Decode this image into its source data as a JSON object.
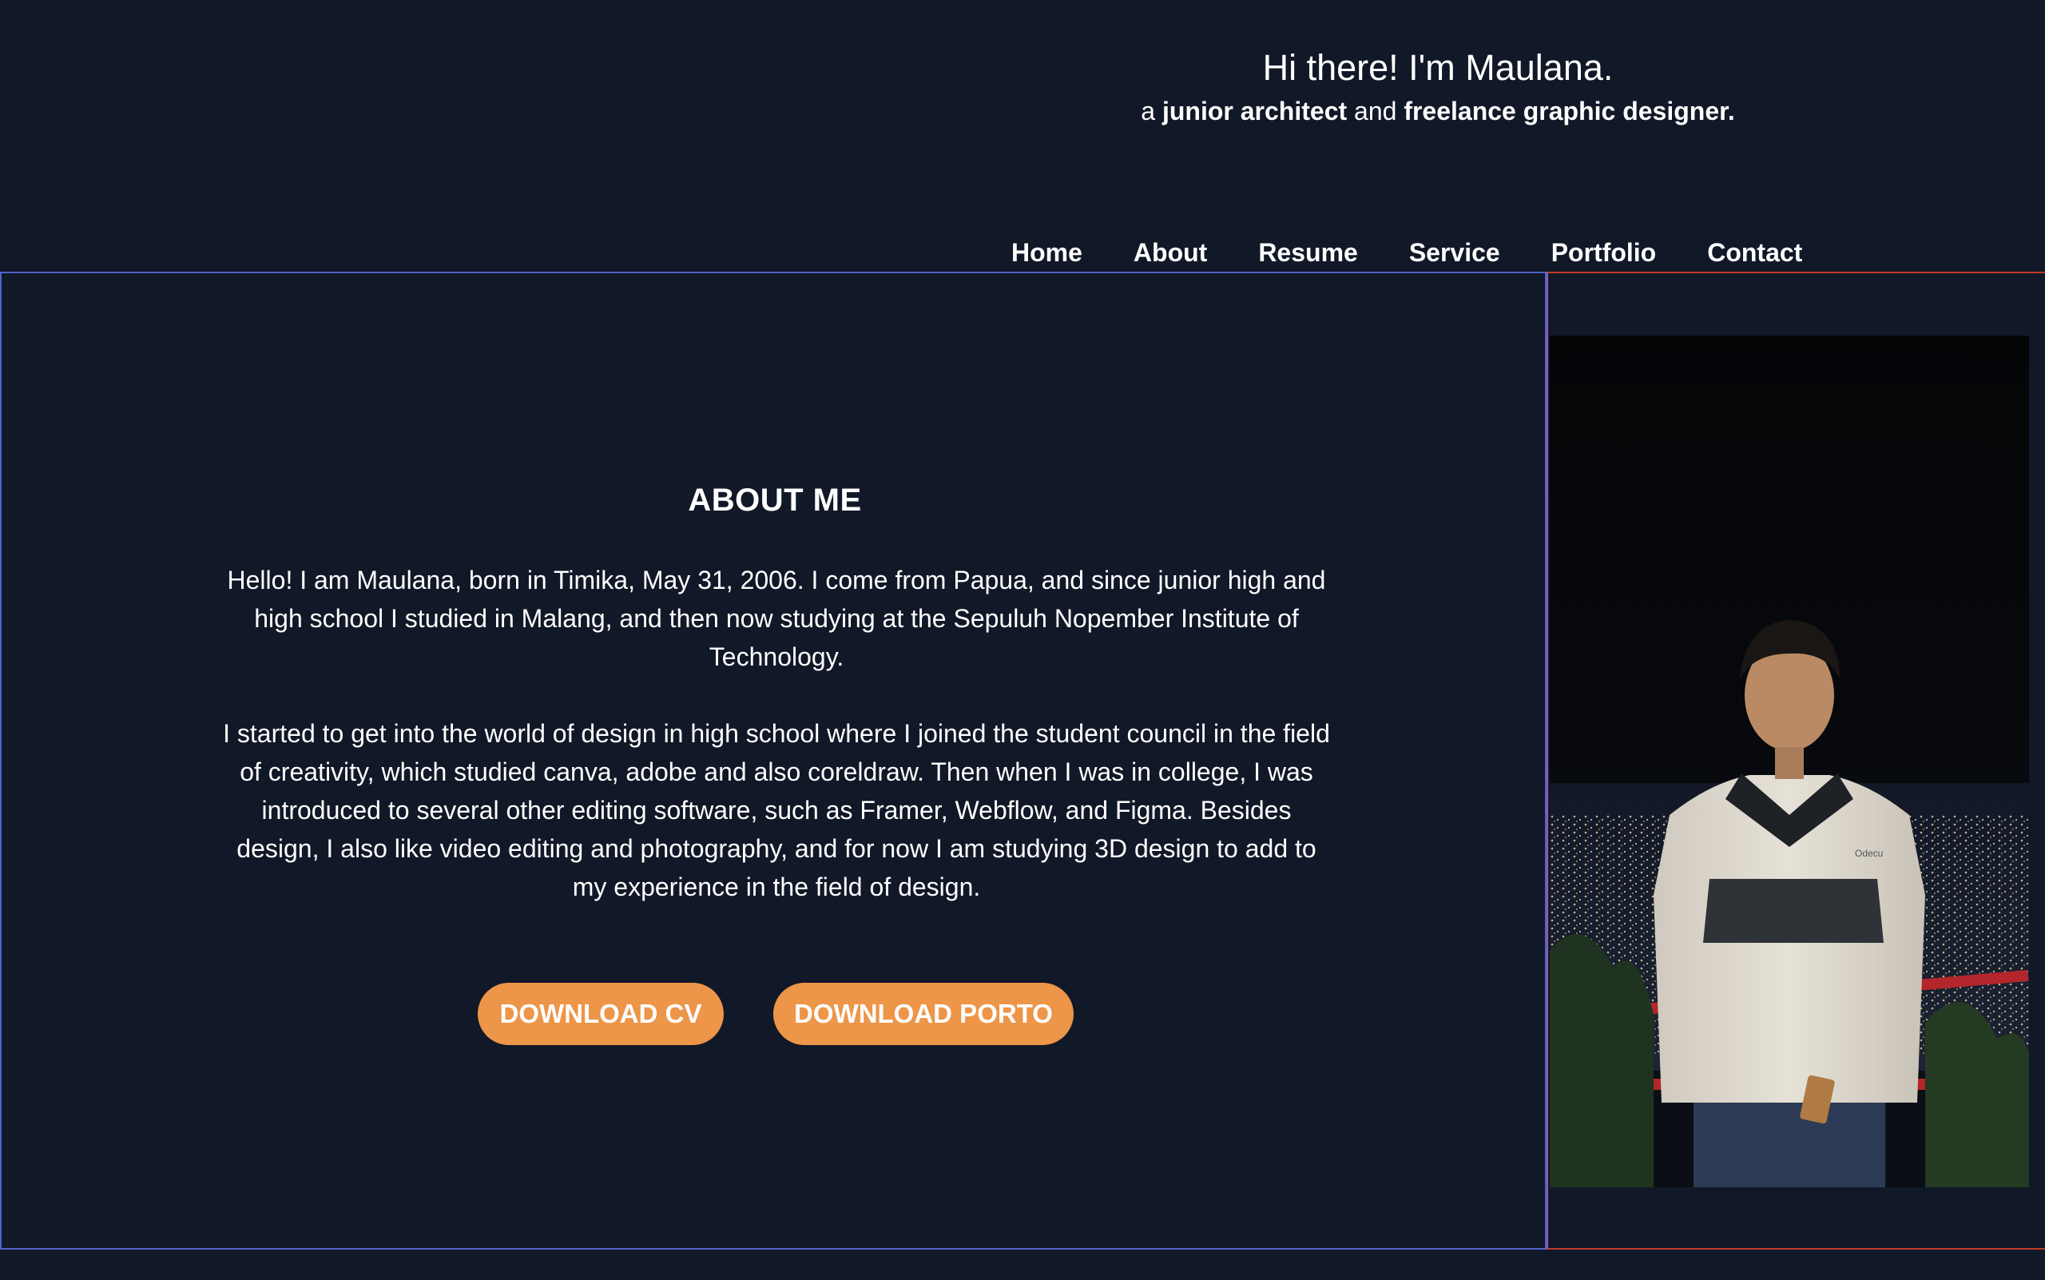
{
  "header": {
    "greeting": "Hi there! I'm Maulana.",
    "tagline_prefix": "a ",
    "tagline_role1": "junior architect",
    "tagline_and": " and ",
    "tagline_role2": "freelance graphic designer."
  },
  "nav": {
    "items": [
      {
        "label": "Home"
      },
      {
        "label": "About"
      },
      {
        "label": "Resume"
      },
      {
        "label": "Service"
      },
      {
        "label": "Portfolio"
      },
      {
        "label": "Contact"
      }
    ]
  },
  "about": {
    "heading": "ABOUT ME",
    "paragraph1": "Hello! I am Maulana, born in Timika, May 31, 2006. I come from Papua, and since junior high and high school I studied in Malang, and then now studying at the Sepuluh Nopember Institute of Technology.",
    "paragraph2": "I started to get into the world of design in high school where I joined the student council in the field of creativity, which studied canva, adobe and also coreldraw. Then when I was in college, I was introduced to several other editing software, such as Framer, Webflow, and Figma. Besides design, I also like video editing and photography, and for now I am studying 3D design to add to my experience in the field of design.",
    "buttons": {
      "download_cv": "DOWNLOAD CV",
      "download_porto": "DOWNLOAD PORTO"
    }
  },
  "photo": {
    "jacket_text": "Odecu"
  },
  "colors": {
    "background": "#111827",
    "accent": "#ed9548",
    "about_border": "#4f63c7",
    "photo_border": "#c0392b"
  }
}
